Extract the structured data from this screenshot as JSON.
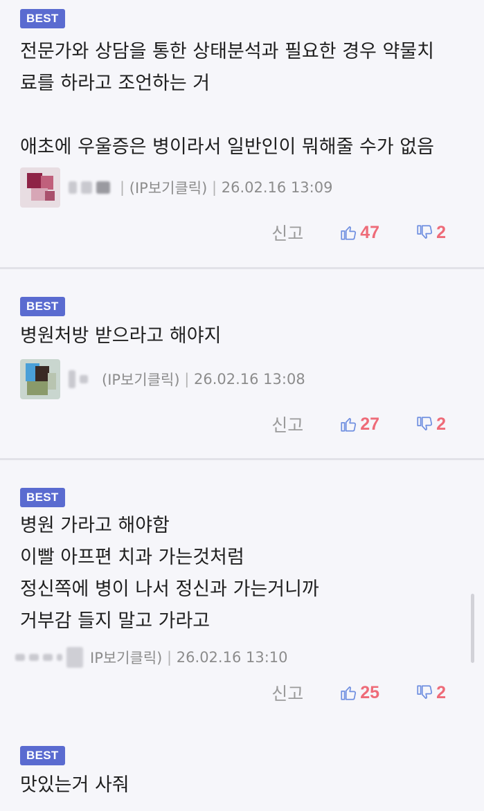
{
  "best_label": "BEST",
  "action_labels": {
    "report": "신고"
  },
  "comments": [
    {
      "text_lines": [
        "전문가와 상담을 통한 상태분석과 필요한 경우 약물치",
        "료를 하라고 조언하는 거",
        "",
        "애초에 우울증은 병이라서 일반인이 뭐해줄 수가 없음"
      ],
      "ip_label": "(IP보기클릭)",
      "date": "26.02.16 13:09",
      "likes": "47",
      "dislikes": "2"
    },
    {
      "text_lines": [
        "병원처방 받으라고 해야지"
      ],
      "ip_label": "(IP보기클릭)",
      "date": "26.02.16 13:08",
      "likes": "27",
      "dislikes": "2"
    },
    {
      "text_lines": [
        "병원 가라고 해야함",
        "이빨 아프편 치과 가는것처럼",
        "정신쪽에 병이 나서 정신과 가는거니까",
        "거부감 들지 말고 가라고"
      ],
      "ip_label": "IP보기클릭)",
      "date": "26.02.16 13:10",
      "likes": "25",
      "dislikes": "2"
    },
    {
      "text_lines": [
        "맛있는거 사줘"
      ]
    }
  ],
  "colors": {
    "badge": "#5a6bd0",
    "like_icon": "#6f8fe0",
    "count": "#ee6b78",
    "background": "#f6f6fa"
  }
}
